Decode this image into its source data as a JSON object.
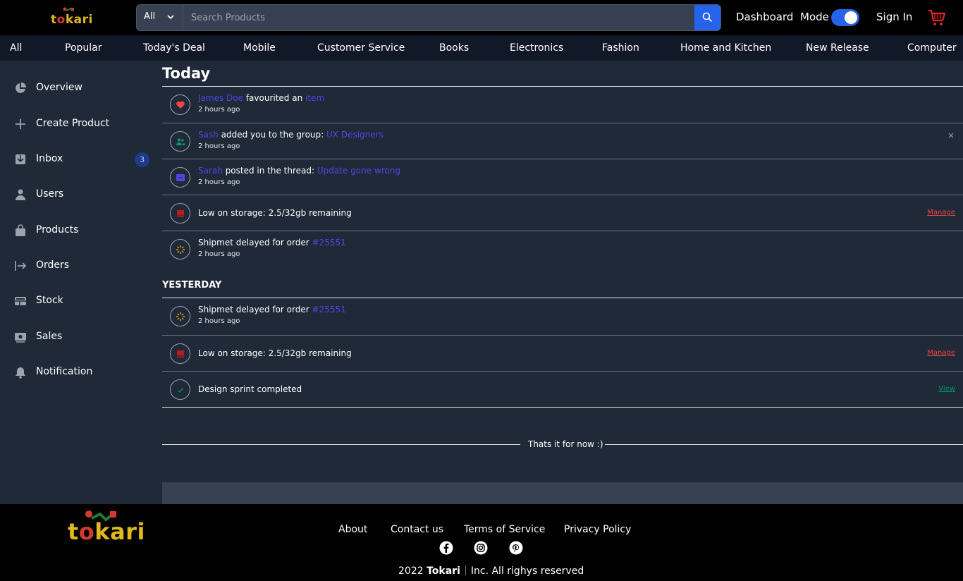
{
  "header": {
    "logo_text": "tokari",
    "search": {
      "category": "All",
      "placeholder": "Search Products"
    },
    "dashboard": "Dashboard",
    "mode": "Mode",
    "mode_on": true,
    "signin": "Sign In",
    "accent": "#2563eb"
  },
  "catnav": [
    "All",
    "Popular",
    "Today's Deal",
    "Mobile",
    "Customer Service",
    "Books",
    "Electronics",
    "Fashion",
    "Home and Kitchen",
    "New Release",
    "Computer"
  ],
  "sidebar": {
    "items": [
      {
        "label": "Overview",
        "icon": "pie-chart-icon"
      },
      {
        "label": "Create Product",
        "icon": "plus-icon"
      },
      {
        "label": "Inbox",
        "icon": "inbox-icon",
        "badge": "3"
      },
      {
        "label": "Users",
        "icon": "user-icon"
      },
      {
        "label": "Products",
        "icon": "shopping-bag-icon"
      },
      {
        "label": "Orders",
        "icon": "arrow-right-bar-icon"
      },
      {
        "label": "Stock",
        "icon": "table-icon"
      },
      {
        "label": "Sales",
        "icon": "cash-icon"
      },
      {
        "label": "Notification",
        "icon": "bell-icon"
      }
    ]
  },
  "main": {
    "today_heading": "Today",
    "yesterday_heading": "YESTERDAY",
    "today": [
      {
        "icon": "heart-icon",
        "actor": "James Doe",
        "text": " favourited an ",
        "link": "item",
        "time": "2 hours ago"
      },
      {
        "icon": "users-group-icon",
        "actor": "Sash",
        "text": " added you to the group: ",
        "link": "UX Designers",
        "time": "2 hours ago",
        "dismiss": "×"
      },
      {
        "icon": "message-icon",
        "actor": "Sarah",
        "text": " posted in the thread: ",
        "link": "Update gone wrong",
        "time": "2 hours ago"
      },
      {
        "icon": "storage-icon",
        "alert": "Low on storage: 2.5/32gb remaining",
        "action": "Manage"
      },
      {
        "icon": "loading-icon",
        "text": "Shipmet delayed for order ",
        "link": "#25551",
        "time": "2 hours ago"
      }
    ],
    "yesterday": [
      {
        "icon": "loading-icon",
        "text": "Shipmet delayed for order ",
        "link": "#25551",
        "time": "2 hours ago"
      },
      {
        "icon": "storage-icon",
        "alert": "Low on storage: 2.5/32gb remaining",
        "action": "Manage"
      },
      {
        "icon": "check-icon",
        "success": "Design sprint completed",
        "action": "View"
      }
    ],
    "end_text": "Thats it for now :)"
  },
  "footer": {
    "logo_text": "tokari",
    "links": [
      "About",
      "Contact us",
      "Terms of Service",
      "Privacy Policy"
    ],
    "social": [
      "facebook-icon",
      "instagram-icon",
      "pinterest-icon"
    ],
    "copy_year": "2022",
    "copy_brand": "Tokari",
    "copy_rest": "Inc. All righys reserved"
  }
}
